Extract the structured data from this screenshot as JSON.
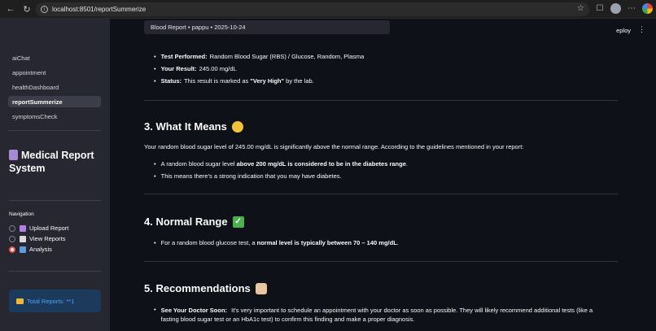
{
  "browser": {
    "url": "localhost:8501/reportSummerize"
  },
  "sidebar": {
    "nav_links": [
      "aiChat",
      "appointment",
      "healthDashboard",
      "reportSummerize",
      "symptomsCheck"
    ],
    "active_index": 3,
    "title": "Medical Report System",
    "navigation_label": "Navigation",
    "radio_options": [
      {
        "label": "Upload Report",
        "checked": false,
        "emoji_color": "#b47fe0"
      },
      {
        "label": "View Reports",
        "checked": false,
        "emoji_color": "#d9d9d9"
      },
      {
        "label": "Analysis",
        "checked": true,
        "emoji_color": "#5a9bd8"
      }
    ],
    "total_reports": "Total Reports: **1"
  },
  "main": {
    "tooltip": "Blood Report • pappu • 2025-10-24",
    "deploy": "eploy",
    "kebab": "⋮",
    "bullets_top": [
      {
        "bold": "Test Performed:",
        "text": "Random Blood Sugar (RBS) / Glucose, Random, Plasma"
      },
      {
        "bold": "Your Result:",
        "text": "245.00 mg/dL"
      },
      {
        "bold": "Status:",
        "text": "This result is marked as ",
        "bold2": "\"Very High\"",
        "tail": " by the lab."
      }
    ],
    "section3": {
      "title": "3. What It Means",
      "intro": "Your random blood sugar level of 245.00 mg/dL is significantly above the normal range. According to the guidelines mentioned in your report:",
      "bullet1_pre": "A random blood sugar level ",
      "bullet1_bold": "above 200 mg/dL is considered to be in the diabetes range",
      "bullet1_tail": ".",
      "bullet2": "This means there's a strong indication that you may have diabetes."
    },
    "section4": {
      "title": "4. Normal Range",
      "bullet_pre": "For a random blood glucose test, a ",
      "bullet_bold": "normal level is typically between 70 – 140 mg/dL",
      "bullet_tail": "."
    },
    "section5": {
      "title": "5. Recommendations",
      "bullet_bold": "See Your Doctor Soon:",
      "bullet_text": "It's very important to schedule an appointment with your doctor as soon as possible. They will likely recommend additional tests (like a",
      "bullet_text2": "fasting blood sugar test or an HbA1c test) to confirm this finding and make a proper diagnosis."
    }
  }
}
